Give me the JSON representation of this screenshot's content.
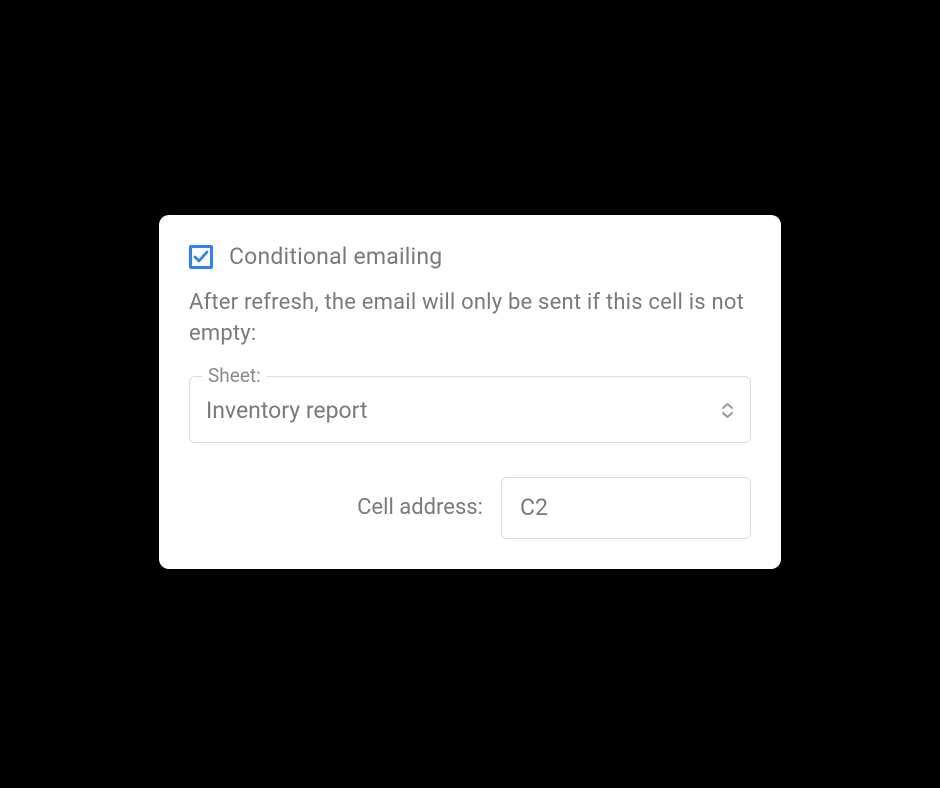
{
  "panel": {
    "checkbox_label": "Conditional emailing",
    "checkbox_checked": true,
    "description": "After refresh, the email will only be sent if this cell is not empty:",
    "sheet": {
      "legend": "Sheet:",
      "value": "Inventory report"
    },
    "cell": {
      "label": "Cell address:",
      "value": "C2"
    }
  },
  "colors": {
    "accent": "#2e84f6",
    "text_muted": "#7a7a7a",
    "border": "#dcdcdc"
  }
}
